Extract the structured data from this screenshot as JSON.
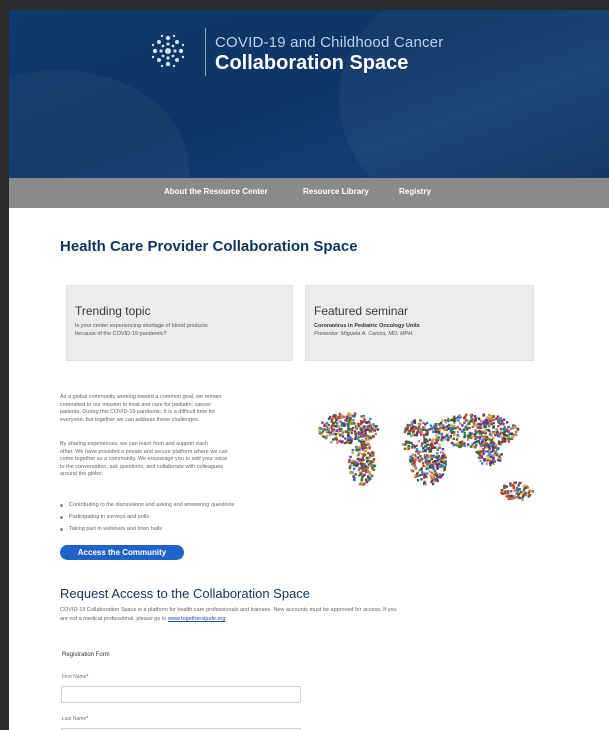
{
  "header": {
    "subtitle": "COVID-19 and Childhood Cancer",
    "title": "Collaboration Space"
  },
  "nav": {
    "items": [
      {
        "label": "About the Resource Center"
      },
      {
        "label": "Resource Library"
      },
      {
        "label": "Registry"
      }
    ]
  },
  "page_title": "Health Care Provider Collaboration Space",
  "cards": {
    "trending": {
      "heading": "Trending topic",
      "line1": "Is your center experiencing shortage of blood products",
      "line2": "because of the COVID-19 pandemic?"
    },
    "seminar": {
      "heading": "Featured seminar",
      "line1": "Coronavirus in Pediatric Oncology Units",
      "line2": "Presenter: Miguela A. Caniza, MD, MPH"
    }
  },
  "intro": {
    "paragraph1": [
      "As a global community working toward a common goal, we remain",
      "committed to our mission to treat and care for pediatric cancer",
      "patients. During this COVID-19 pandemic, it is a difficult time for",
      "everyone, but together we can address these challenges."
    ],
    "paragraph2": [
      "By sharing experiences, we can learn from and support each",
      "other. We have provided a private and secure platform where we can",
      "come together as a community. We encourage you to add your voice",
      "to the conversation, ask questions, and collaborate with colleagues",
      "around the globe:"
    ],
    "bullets": [
      "Contributing to the discussions and asking and answering questions",
      "Participating in surveys and polls",
      "Taking part in webinars and town halls"
    ]
  },
  "cta_label": "Access the Community",
  "request": {
    "title": "Request Access to the Collaboration Space",
    "desc_line1": "COVID-19 Collaboration Space is a platform for health care professionals and trainees. New accounts must be approved for access. If you",
    "desc_line2_prefix": "are not a medical professional, please go to ",
    "desc_link": "www.togetherstjude.org"
  },
  "form": {
    "title": "Registration Form",
    "first_name_label": "First Name",
    "last_name_label": "Last Name",
    "required_mark": "*",
    "first_name_value": "",
    "last_name_value": ""
  },
  "colors": {
    "hero_blue": "#0f3a6b",
    "nav_gray": "#8a8a8a",
    "title_navy": "#12335e",
    "button_blue": "#1f63c9",
    "required_red": "#cc1b1b"
  },
  "icons": {
    "logo": "starburst-logo-icon",
    "world_map": "world-map-mosaic"
  }
}
